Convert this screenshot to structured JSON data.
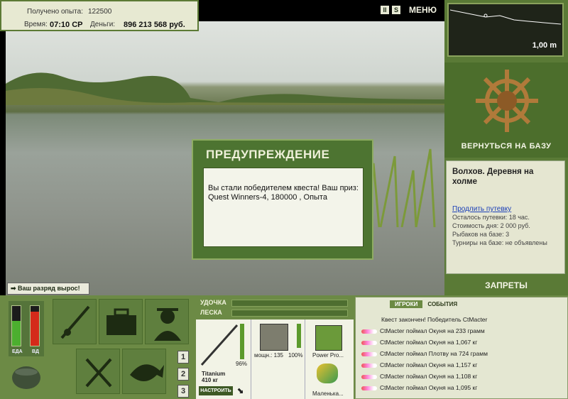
{
  "info": {
    "exp_label": "Получено опыта:",
    "exp_value": "122500",
    "time_label": "Время:",
    "time_value": "07:10 СР",
    "money_label": "Деньги:",
    "money_value": "896 213 568 руб."
  },
  "top_controls": {
    "pause": "II",
    "s": "S",
    "menu": "МЕНЮ"
  },
  "depth": {
    "value": "1,00 m"
  },
  "base": {
    "return_label": "ВЕРНУТЬСЯ НА БАЗУ",
    "name": "Волхов. Деревня на холме",
    "extend_link": "Продлить путевку",
    "remaining": "Осталось путевки: 18 час.",
    "day_cost": "Стоимость дня: 2 000 руб.",
    "fishers": "Рыбаков на базе: 3",
    "tournaments": "Турниры на базе: не объявлены",
    "bans_label": "ЗАПРЕТЫ"
  },
  "dialog": {
    "title": "ПРЕДУПРЕЖДЕНИЕ",
    "line1": "Вы стали победителем квеста! Ваш приз:",
    "line2": "Quest Winners-4, 180000 , Опыта"
  },
  "rank_message": "Ваш разряд вырос!",
  "meters": {
    "food_label": "ЕДА",
    "food_level": 0.62,
    "alcohol_label": "ВД",
    "alcohol_level": 0.85
  },
  "tension": {
    "rod_label": "УДОЧКА",
    "line_label": "ЛЕСКА"
  },
  "slot_numbers": [
    "1",
    "2",
    "3"
  ],
  "gear": {
    "rod_name": "Titanium",
    "rod_weight": "410 кг",
    "rod_percent": "96%",
    "reel_power": "мощн.: 135",
    "reel_percent": "100%",
    "line_name": "Power Pro...",
    "lure_name": "Маленька...",
    "setup_button": "НАСТРОИТЬ"
  },
  "events": {
    "tab_players": "ИГРОКИ",
    "tab_events": "СОБЫТИЯ",
    "items": [
      "Квест закончен! Победитель CtMacter",
      "CtMacter поймал Окуня на 233 грамм",
      "CtMacter поймал Окуня на 1,067 кг",
      "CtMacter поймал Плотву на 724 грамм",
      "CtMacter поймал Окуня на 1,157 кг",
      "CtMacter поймал Окуня на 1,108 кг",
      "CtMacter поймал Окуня на 1,095 кг"
    ]
  },
  "colors": {
    "panel_green": "#5a7a36",
    "panel_light": "#e5e6d1",
    "accent": "#4d7431"
  }
}
